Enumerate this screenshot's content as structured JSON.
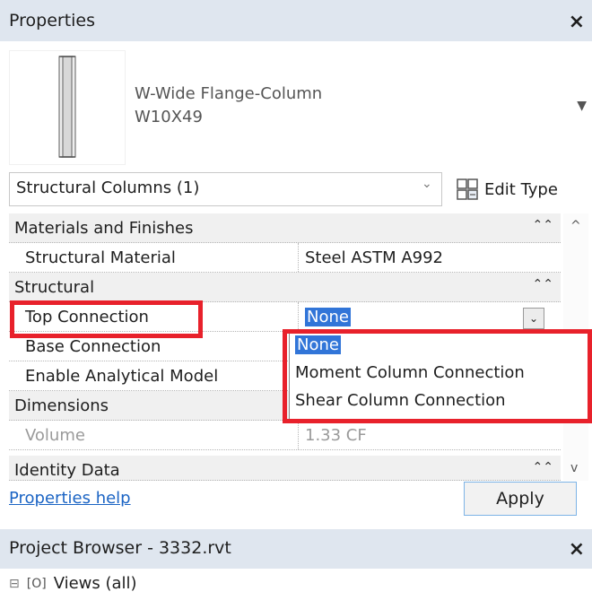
{
  "properties_panel": {
    "title": "Properties",
    "close_glyph": "×",
    "type_selector": {
      "family": "W-Wide Flange-Column",
      "type": "W10X49",
      "thumbnail_icon": "wide-flange-column-icon"
    },
    "instance_filter": {
      "label": "Structural Columns (1)",
      "edit_type_label": "Edit Type",
      "edit_type_icon": "edit-type-icon"
    },
    "categories": {
      "materials": {
        "label": "Materials and Finishes",
        "rows": [
          {
            "label": "Structural Material",
            "value": "Steel ASTM A992"
          }
        ]
      },
      "structural": {
        "label": "Structural",
        "rows": [
          {
            "label": "Top Connection",
            "value": "None"
          },
          {
            "label": "Base Connection",
            "value": ""
          },
          {
            "label": "Enable Analytical Model",
            "value": ""
          }
        ]
      },
      "dimensions": {
        "label": "Dimensions",
        "rows": [
          {
            "label": "Volume",
            "value": "1.33 CF"
          }
        ]
      },
      "identity": {
        "label": "Identity Data"
      }
    },
    "dropdown_options": [
      "None",
      "Moment Column Connection",
      "Shear Column Connection"
    ],
    "help_link": "Properties help",
    "apply_label": "Apply"
  },
  "project_browser": {
    "title": "Project Browser - 3332.rvt",
    "close_glyph": "×",
    "tree_root": "Views (all)"
  },
  "colors": {
    "panel_header": "#dfe6ef",
    "selection": "#3175d8",
    "highlight_box": "#e8212b",
    "link": "#1b64c4"
  }
}
